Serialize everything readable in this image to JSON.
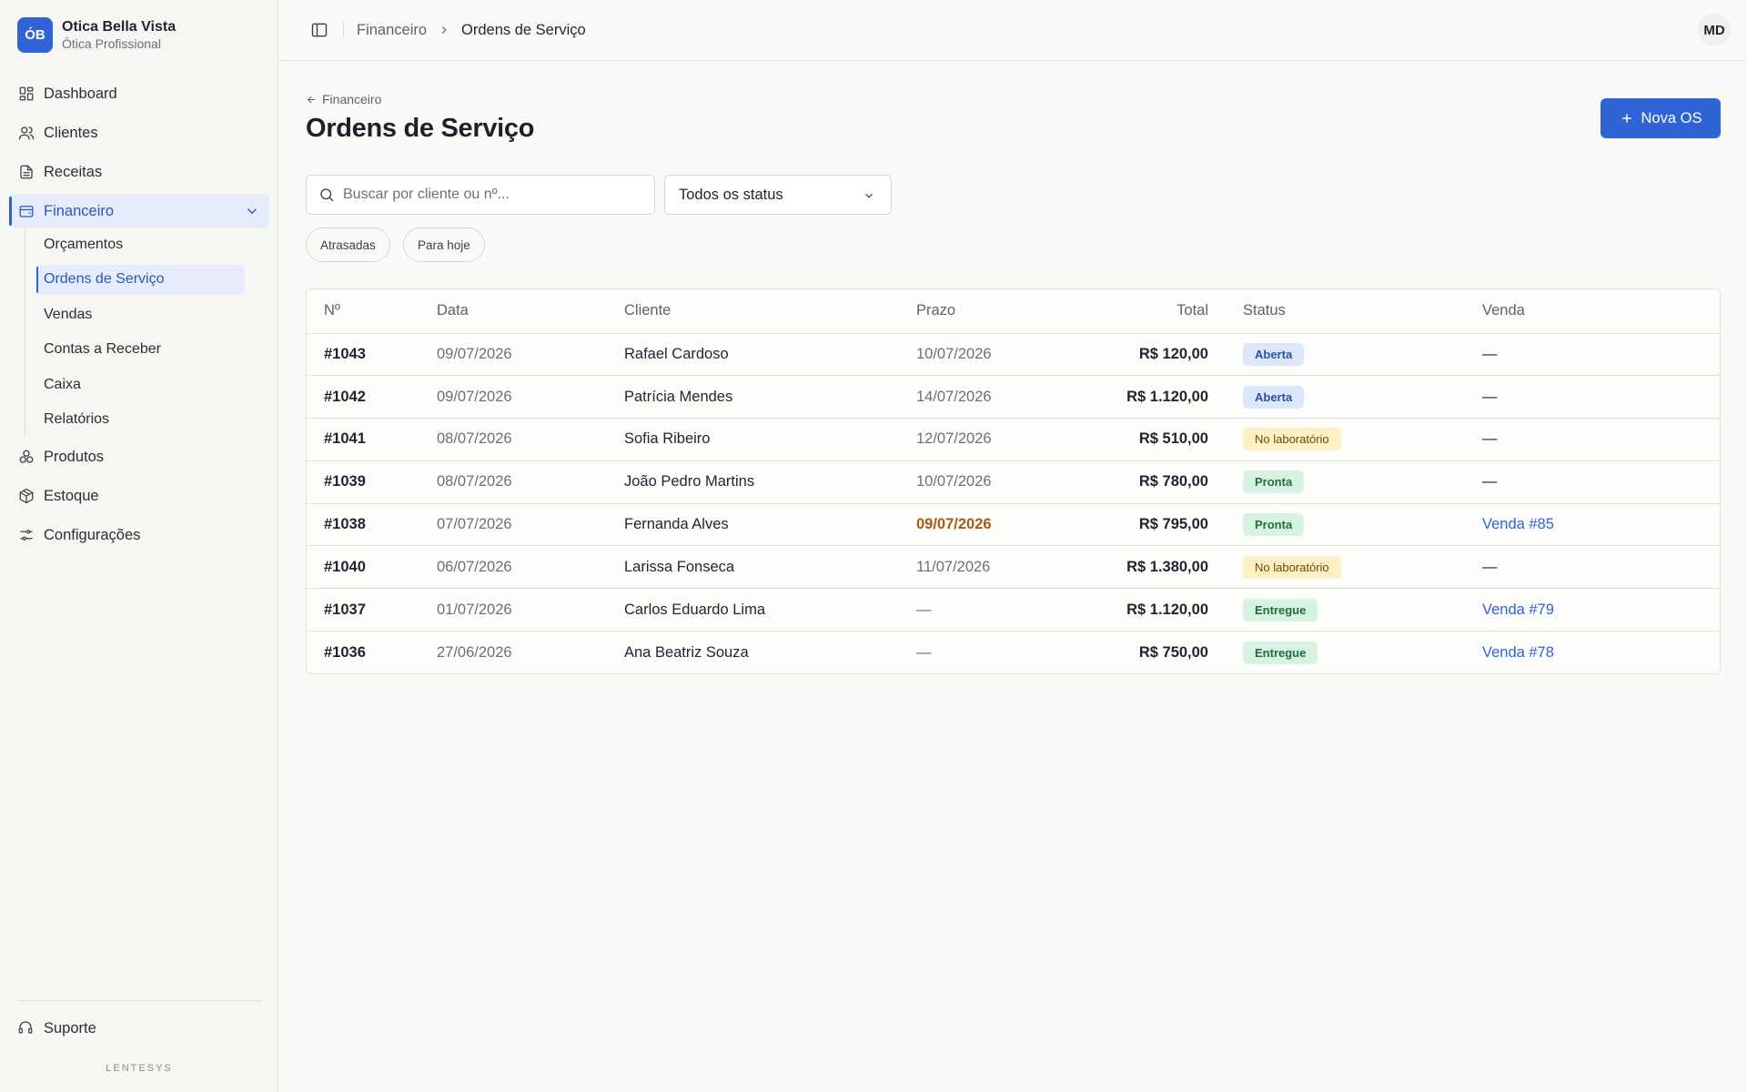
{
  "brand": {
    "logo": "ÓB",
    "name": "Otica Bella Vista",
    "subtitle": "Ótica Profissional"
  },
  "sidebar": {
    "items": [
      {
        "label": "Dashboard",
        "icon": "dashboard-icon"
      },
      {
        "label": "Clientes",
        "icon": "users-icon"
      },
      {
        "label": "Receitas",
        "icon": "file-icon"
      },
      {
        "label": "Financeiro",
        "icon": "wallet-icon",
        "active": true,
        "expanded": true
      },
      {
        "label": "Produtos",
        "icon": "boxes-icon"
      },
      {
        "label": "Estoque",
        "icon": "package-icon"
      },
      {
        "label": "Configurações",
        "icon": "sliders-icon"
      }
    ],
    "subitems": [
      "Orçamentos",
      "Ordens de Serviço",
      "Vendas",
      "Contas a Receber",
      "Caixa",
      "Relatórios"
    ],
    "support": "Suporte",
    "footer": "LENTESYS"
  },
  "header": {
    "breadcrumb": [
      "Financeiro",
      "Ordens de Serviço"
    ],
    "avatar": "MD"
  },
  "main": {
    "back_label": "Financeiro",
    "title": "Ordens de Serviço",
    "new_button": "Nova OS",
    "search_placeholder": "Buscar por cliente ou nº...",
    "status_filter": "Todos os status",
    "chips": [
      "Atrasadas",
      "Para hoje"
    ]
  },
  "table": {
    "headers": [
      "Nº",
      "Data",
      "Cliente",
      "Prazo",
      "Total",
      "Status",
      "Venda"
    ],
    "rows": [
      {
        "num": "#1043",
        "data": "09/07/2026",
        "cliente": "Rafael Cardoso",
        "prazo": "10/07/2026",
        "total": "R$ 120,00",
        "status": "Aberta",
        "venda": "—"
      },
      {
        "num": "#1042",
        "data": "09/07/2026",
        "cliente": "Patrícia Mendes",
        "prazo": "14/07/2026",
        "total": "R$ 1.120,00",
        "status": "Aberta",
        "venda": "—"
      },
      {
        "num": "#1041",
        "data": "08/07/2026",
        "cliente": "Sofia Ribeiro",
        "prazo": "12/07/2026",
        "total": "R$ 510,00",
        "status": "No laboratório",
        "venda": "—"
      },
      {
        "num": "#1039",
        "data": "08/07/2026",
        "cliente": "João Pedro Martins",
        "prazo": "10/07/2026",
        "total": "R$ 780,00",
        "status": "Pronta",
        "venda": "—"
      },
      {
        "num": "#1038",
        "data": "07/07/2026",
        "cliente": "Fernanda Alves",
        "prazo": "09/07/2026",
        "total": "R$ 795,00",
        "status": "Pronta",
        "venda": "Venda #85"
      },
      {
        "num": "#1040",
        "data": "06/07/2026",
        "cliente": "Larissa Fonseca",
        "prazo": "11/07/2026",
        "total": "R$ 1.380,00",
        "status": "No laboratório",
        "venda": "—"
      },
      {
        "num": "#1037",
        "data": "01/07/2026",
        "cliente": "Carlos Eduardo Lima",
        "prazo": "—",
        "total": "R$ 1.120,00",
        "status": "Entregue",
        "venda": "Venda #79"
      },
      {
        "num": "#1036",
        "data": "27/06/2026",
        "cliente": "Ana Beatriz Souza",
        "prazo": "—",
        "total": "R$ 750,00",
        "status": "Entregue",
        "venda": "Venda #78"
      }
    ]
  },
  "colors": {
    "accent": "#2f63d6",
    "late": "#a7591a"
  }
}
